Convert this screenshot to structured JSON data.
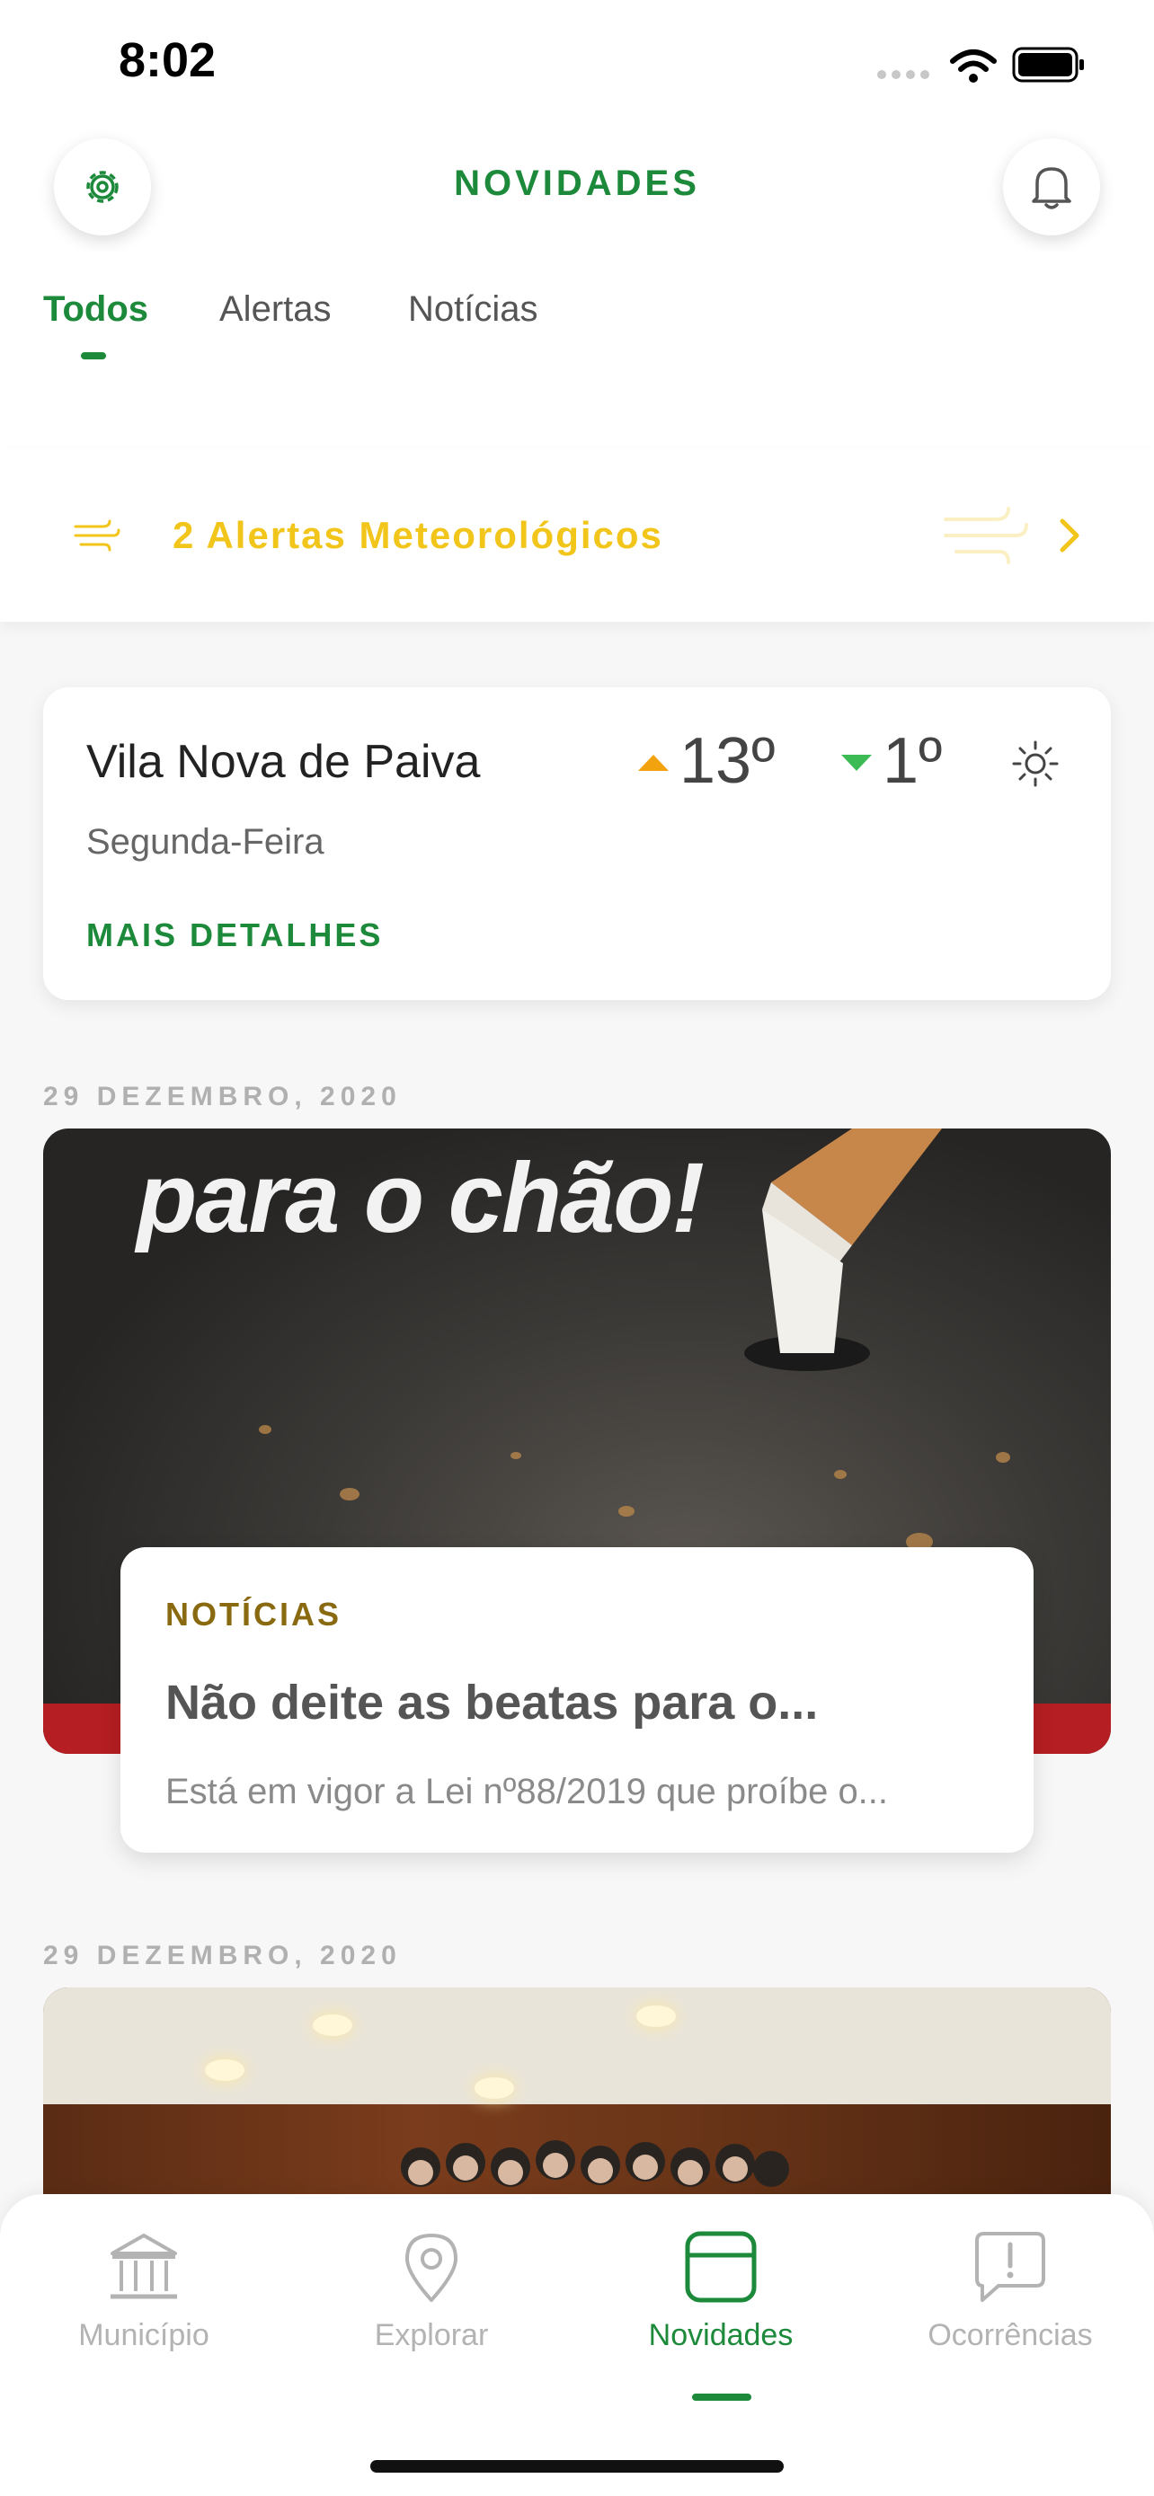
{
  "status_bar": {
    "time": "8:02"
  },
  "header": {
    "title": "NOVIDADES",
    "settings_icon": "gear-icon",
    "notifications_icon": "bell-icon"
  },
  "tabs": [
    {
      "label": "Todos",
      "active": true
    },
    {
      "label": "Alertas",
      "active": false
    },
    {
      "label": "Notícias",
      "active": false
    }
  ],
  "alert_banner": {
    "text": "2 Alertas Meteorológicos",
    "icon": "wind-icon",
    "color": "#f1c51a"
  },
  "weather": {
    "city": "Vila Nova de Paiva",
    "day": "Segunda-Feira",
    "max_temp": "13º",
    "min_temp": "1º",
    "condition_icon": "sun-icon",
    "more_label": "MAIS DETALHES"
  },
  "news": [
    {
      "date": "29 DEZEMBRO, 2020",
      "image_headline": "para o chão!",
      "category": "NOTÍCIAS",
      "title": "Não deite as beatas para o...",
      "excerpt": "Está em vigor a Lei nº88/2019 que proíbe o..."
    },
    {
      "date": "29 DEZEMBRO, 2020"
    }
  ],
  "bottom_nav": [
    {
      "label": "Município",
      "icon": "building-icon",
      "active": false
    },
    {
      "label": "Explorar",
      "icon": "map-pin-icon",
      "active": false
    },
    {
      "label": "Novidades",
      "icon": "news-icon",
      "active": true
    },
    {
      "label": "Ocorrências",
      "icon": "report-icon",
      "active": false
    }
  ],
  "colors": {
    "brand_green": "#1c8a3a",
    "alert_yellow": "#f1c51a",
    "max_temp_orange": "#f2a20f",
    "min_temp_green": "#3cba54"
  }
}
